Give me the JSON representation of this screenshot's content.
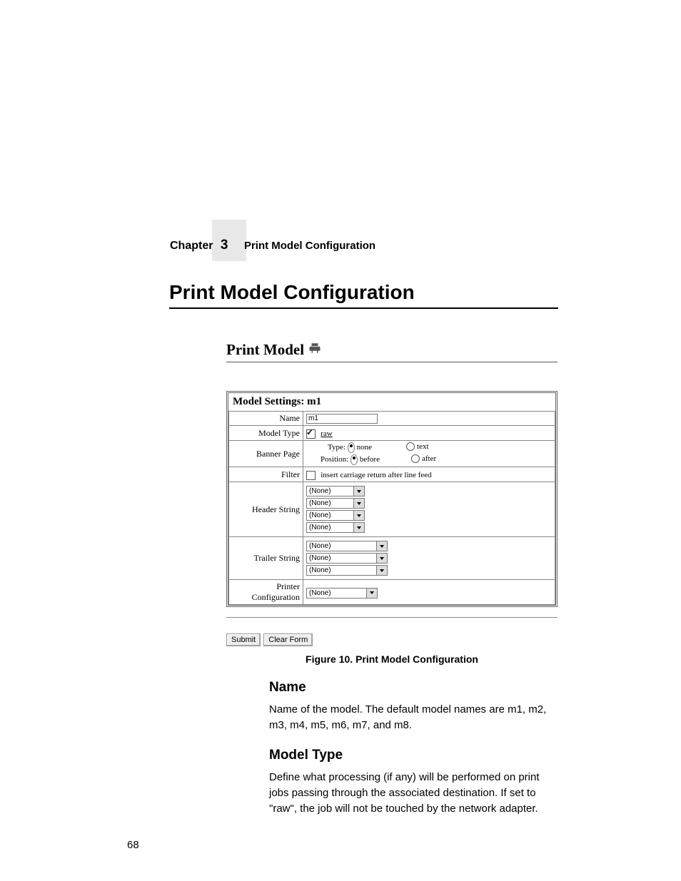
{
  "header": {
    "chapter_word": "Chapter",
    "chapter_num": "3",
    "running_title": "Print Model Configuration"
  },
  "h1": "Print Model Configuration",
  "figure": {
    "title": "Print Model",
    "panel_title": "Model Settings: m1",
    "rows": {
      "name_label": "Name",
      "name_value": "m1",
      "modeltype_label": "Model Type",
      "modeltype_value": "raw",
      "banner_label": "Banner Page",
      "banner_type_label": "Type:",
      "banner_type_opt1": "none",
      "banner_type_opt2": "text",
      "banner_pos_label": "Position:",
      "banner_pos_opt1": "before",
      "banner_pos_opt2": "after",
      "filter_label": "Filter",
      "filter_text": "insert carriage return after line feed",
      "header_label": "Header String",
      "header_opts": [
        "(None)",
        "(None)",
        "(None)",
        "(None)"
      ],
      "trailer_label": "Trailer String",
      "trailer_opts": [
        "(None)",
        "(None)",
        "(None)"
      ],
      "printer_label_l1": "Printer",
      "printer_label_l2": "Configuration",
      "printer_opt": "(None)"
    },
    "buttons": {
      "submit": "Submit",
      "clear": "Clear Form"
    },
    "caption": "Figure 10. Print Model Configuration"
  },
  "sections": {
    "name_h": "Name",
    "name_p": "Name of the model. The default model names are m1, m2, m3, m4, m5, m6, m7, and m8.",
    "mt_h": "Model Type",
    "mt_p": "Define what processing (if any) will be performed on print jobs passing through the associated destination. If set to \"raw\", the job will not be touched by the network adapter."
  },
  "page_number": "68"
}
